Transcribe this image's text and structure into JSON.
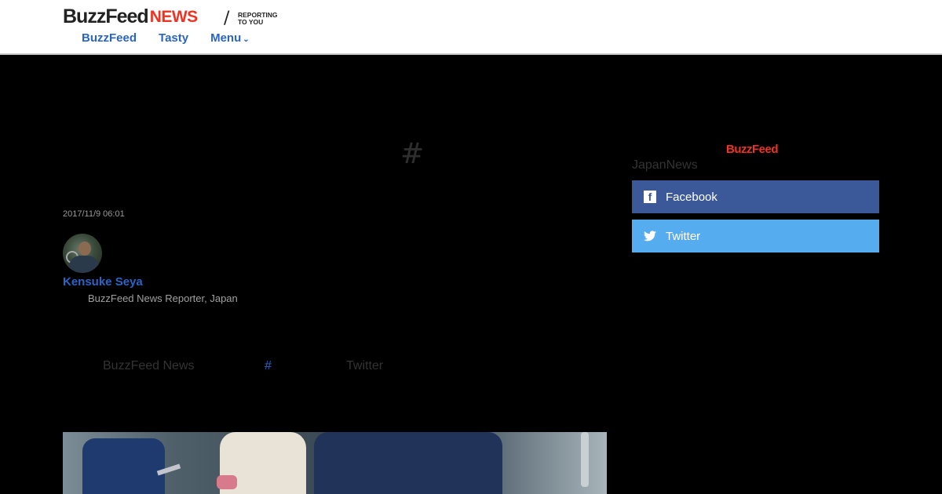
{
  "header": {
    "logo_buzz": "BuzzFeed",
    "logo_news": "NEWS",
    "logo_slash": "/",
    "tagline_line1": "REPORTING",
    "tagline_line2": "TO YOU",
    "nav": [
      {
        "label": "BuzzFeed"
      },
      {
        "label": "Tasty"
      },
      {
        "label": "Menu"
      }
    ]
  },
  "article": {
    "title": "#",
    "timestamp": "2017/11/9 06:01",
    "author": {
      "name": "Kensuke Seya",
      "role": "BuzzFeed News Reporter, Japan"
    },
    "inline": {
      "text1": "BuzzFeed News",
      "hash": "#",
      "text2": "Twitter"
    }
  },
  "sidebar": {
    "brand": "BuzzFeed",
    "label": "JapanNews",
    "facebook_label": "Facebook",
    "twitter_label": "Twitter"
  },
  "colors": {
    "link_blue": "#2a64c4",
    "brand_red": "#ee3322",
    "facebook": "#3b5998",
    "twitter": "#55acee"
  }
}
